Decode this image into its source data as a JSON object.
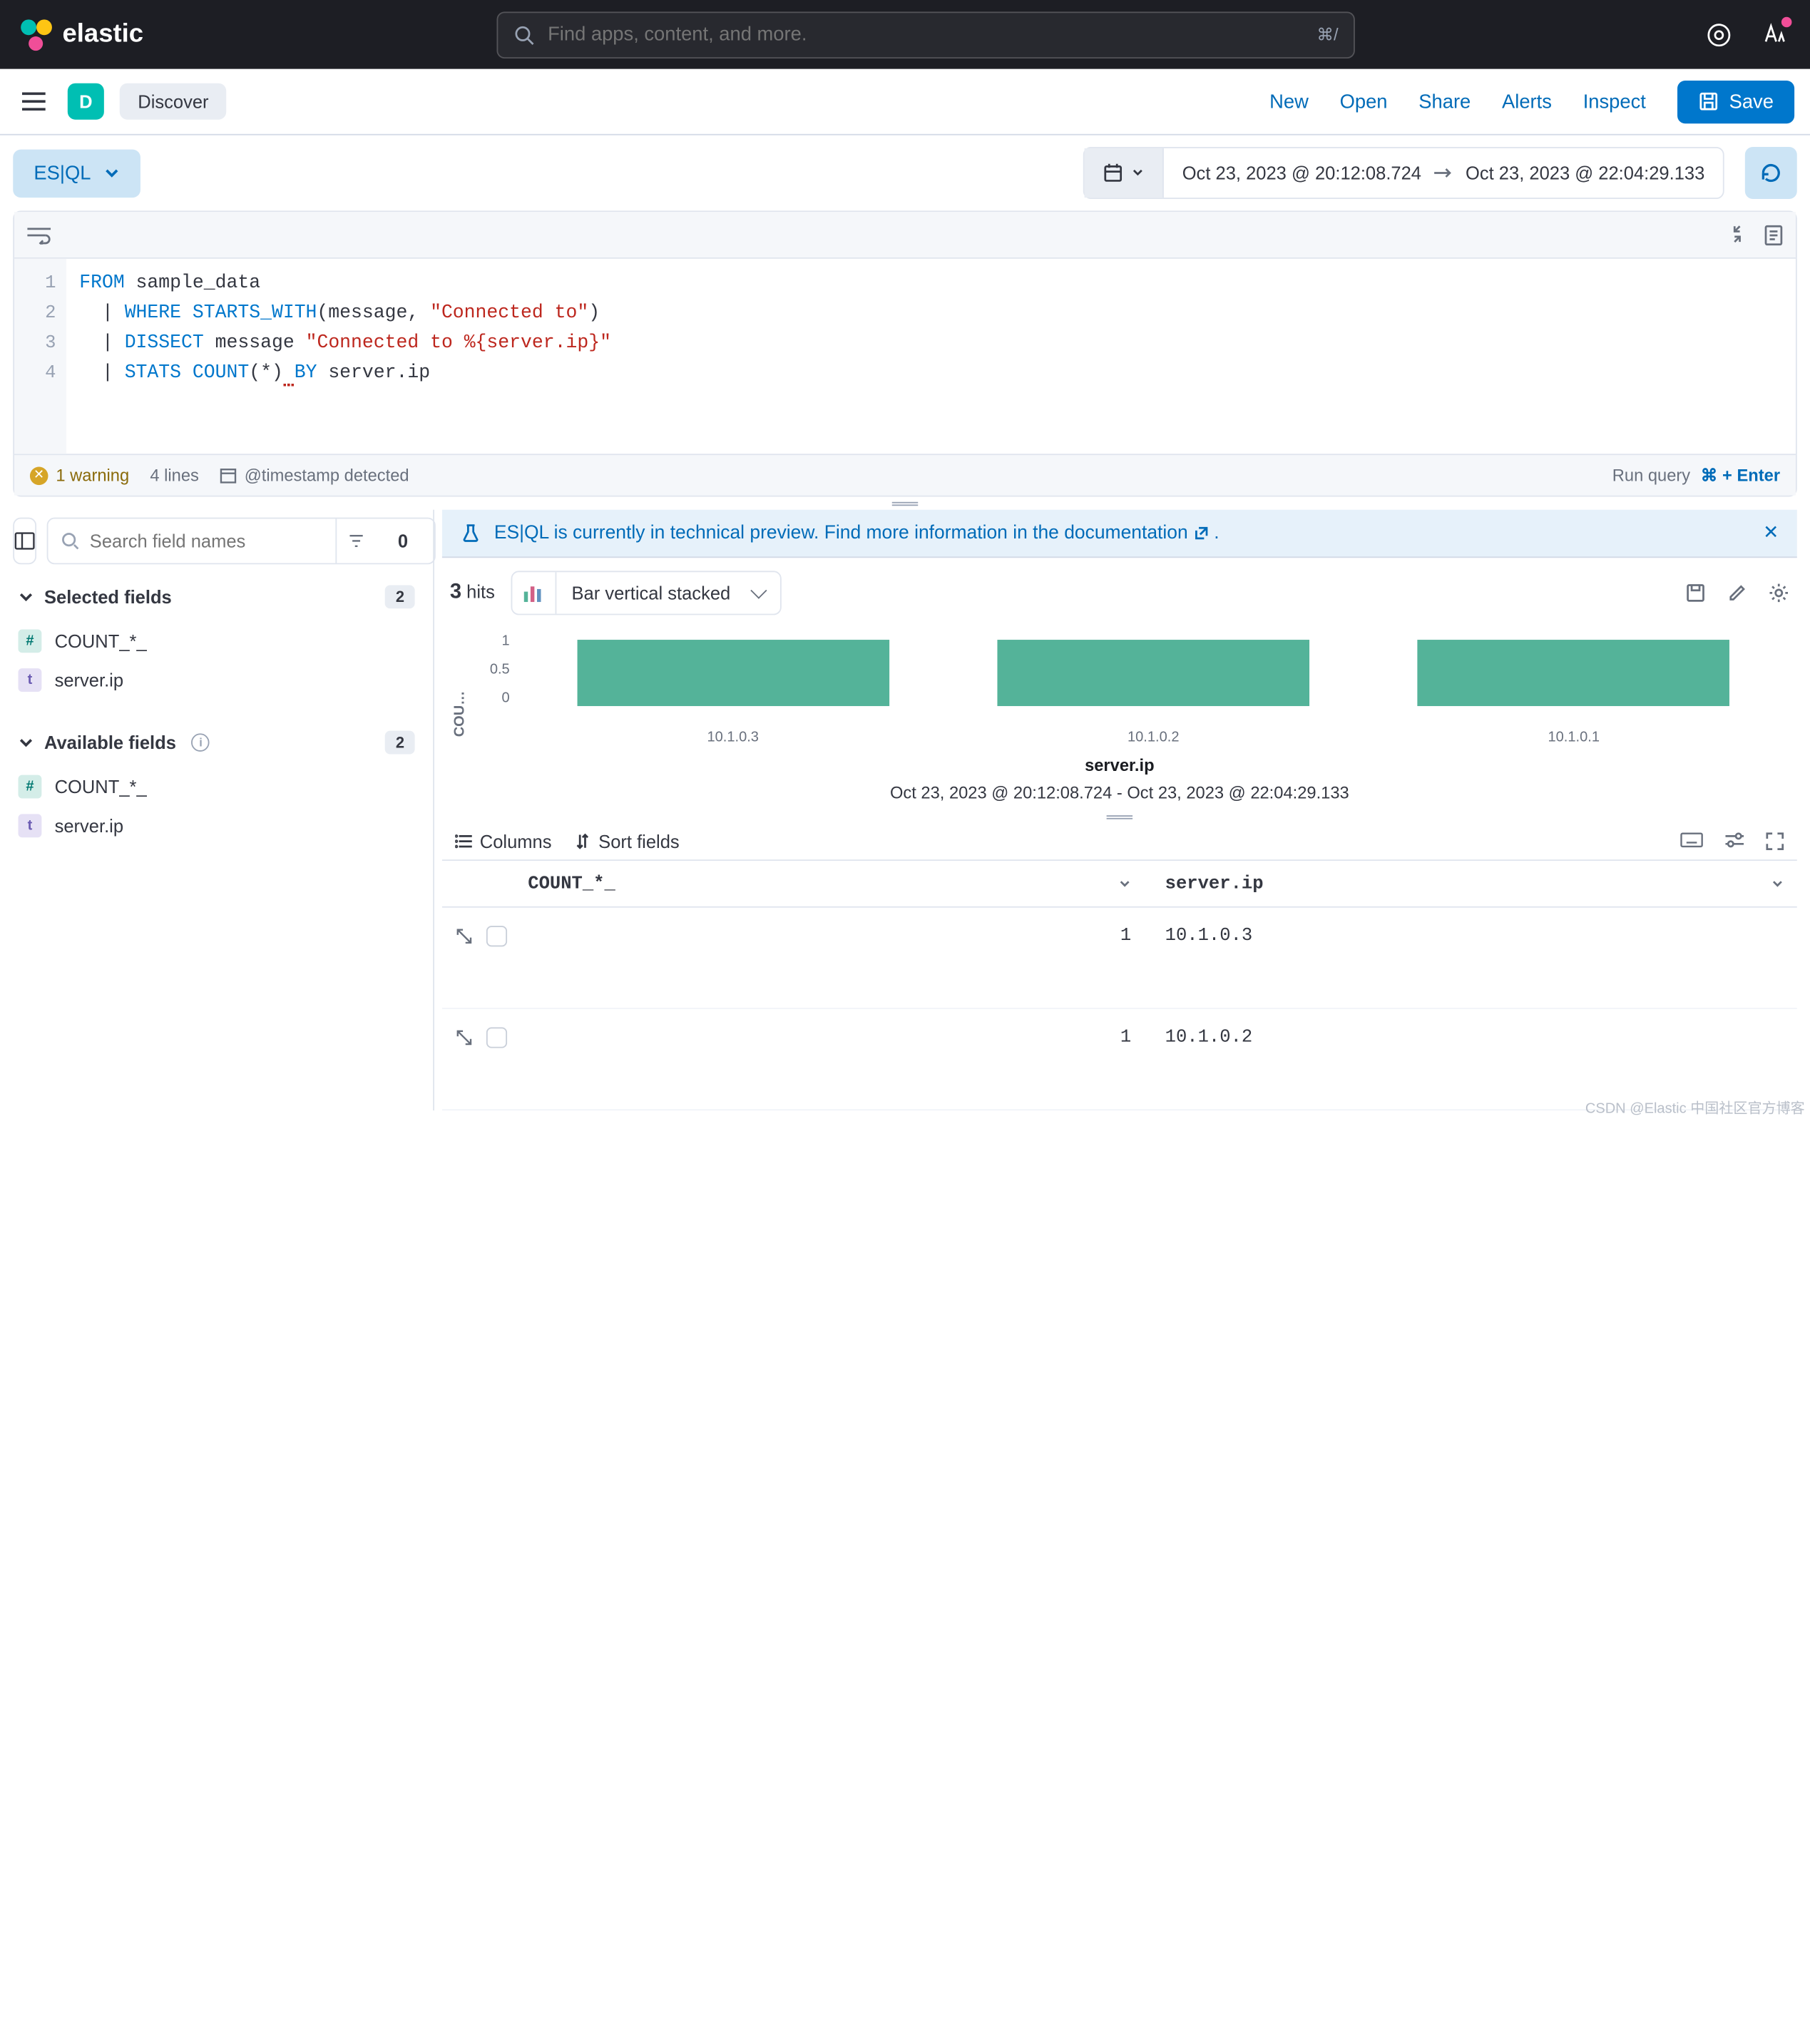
{
  "header": {
    "brand": "elastic",
    "search_placeholder": "Find apps, content, and more.",
    "search_kbd": "⌘/"
  },
  "subheader": {
    "avatar_letter": "D",
    "breadcrumb": "Discover",
    "links": {
      "new": "New",
      "open": "Open",
      "share": "Share",
      "alerts": "Alerts",
      "inspect": "Inspect"
    },
    "save": "Save"
  },
  "querybar": {
    "esql_label": "ES|QL",
    "date_from": "Oct 23, 2023 @ 20:12:08.724",
    "date_to": "Oct 23, 2023 @ 22:04:29.133"
  },
  "editor": {
    "lines": [
      "1",
      "2",
      "3",
      "4"
    ],
    "code": {
      "l1_kw": "FROM",
      "l1_rest": " sample_data",
      "l2_pipe": "  | ",
      "l2_kw": "WHERE ",
      "l2_fn": "STARTS_WITH",
      "l2_open": "(message, ",
      "l2_str": "\"Connected to\"",
      "l2_close": ")",
      "l3_pipe": "  | ",
      "l3_kw": "DISSECT",
      "l3_mid": " message ",
      "l3_str": "\"Connected to %{server.ip}\"",
      "l4_pipe": "  | ",
      "l4_kw": "STATS ",
      "l4_fn": "COUNT",
      "l4_paren": "(*)",
      "l4_sp": " ",
      "l4_kw2": "BY",
      "l4_rest": " server.ip"
    },
    "footer": {
      "warning": "1 warning",
      "linecount": "4 lines",
      "detected": "@timestamp detected",
      "run": "Run query",
      "keys": "⌘ + Enter"
    }
  },
  "sidebar": {
    "search_placeholder": "Search field names",
    "total_count": "0",
    "selected_title": "Selected fields",
    "selected_count": "2",
    "available_title": "Available fields",
    "available_count": "2",
    "fields": {
      "count_label": "COUNT_*_",
      "ip_label": "server.ip",
      "count_type": "#",
      "ip_type": "t"
    }
  },
  "callout": {
    "text_a": "ES|QL is currently in technical preview. ",
    "text_b": "Find more information in the documentation",
    "tail": " ."
  },
  "hits": {
    "count": "3",
    "word": "hits",
    "chart_type": "Bar vertical stacked"
  },
  "chart_data": {
    "type": "bar",
    "categories": [
      "10.1.0.3",
      "10.1.0.2",
      "10.1.0.1"
    ],
    "values": [
      1,
      1,
      1
    ],
    "y_ticks": [
      "1",
      "0.5",
      "0"
    ],
    "ylabel": "COU…",
    "xlabel": "server.ip",
    "ylim": [
      0,
      1
    ],
    "range_text": "Oct 23, 2023 @ 20:12:08.724 - Oct 23, 2023 @ 22:04:29.133"
  },
  "table": {
    "columns_btn": "Columns",
    "sort_btn": "Sort fields",
    "headers": {
      "count": "COUNT_*_",
      "ip": "server.ip"
    },
    "rows": [
      {
        "count": "1",
        "ip": "10.1.0.3"
      },
      {
        "count": "1",
        "ip": "10.1.0.2"
      }
    ]
  },
  "watermark": "CSDN @Elastic 中国社区官方博客"
}
